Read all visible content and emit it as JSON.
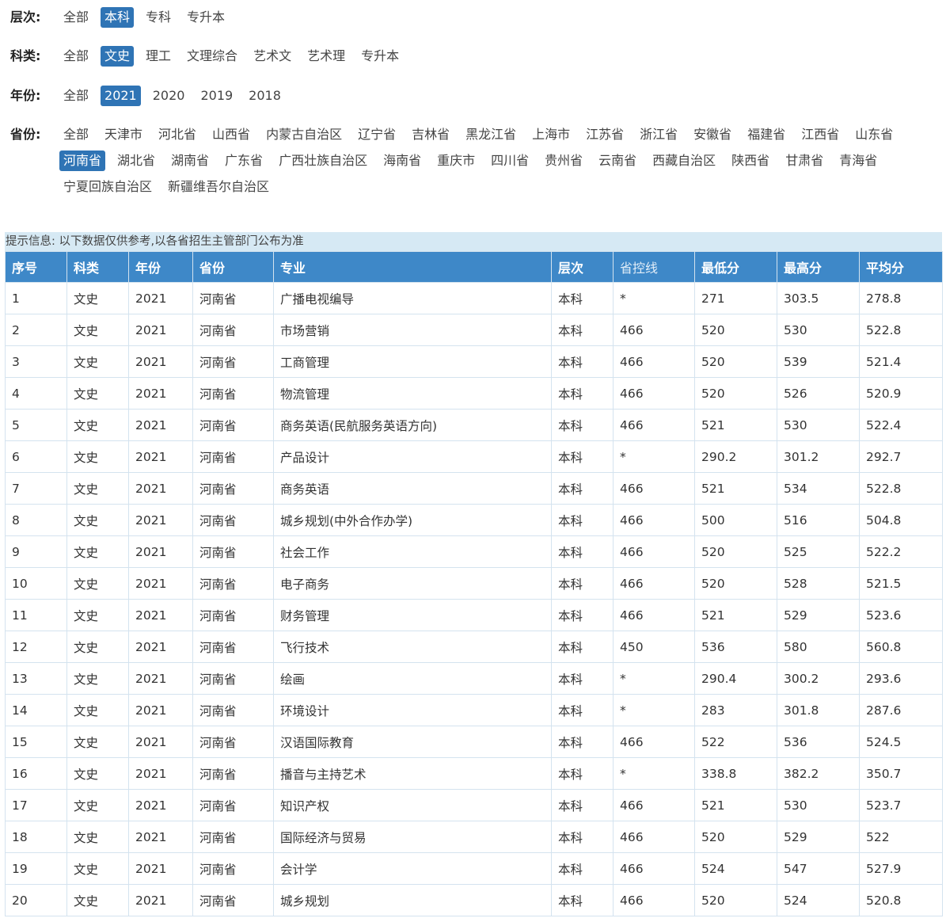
{
  "filters": {
    "level": {
      "label": "层次:",
      "options": [
        "全部",
        "本科",
        "专科",
        "专升本"
      ],
      "active": 1
    },
    "subject": {
      "label": "科类:",
      "options": [
        "全部",
        "文史",
        "理工",
        "文理综合",
        "艺术文",
        "艺术理",
        "专升本"
      ],
      "active": 1
    },
    "year": {
      "label": "年份:",
      "options": [
        "全部",
        "2021",
        "2020",
        "2019",
        "2018"
      ],
      "active": 1
    },
    "province": {
      "label": "省份:",
      "options": [
        "全部",
        "天津市",
        "河北省",
        "山西省",
        "内蒙古自治区",
        "辽宁省",
        "吉林省",
        "黑龙江省",
        "上海市",
        "江苏省",
        "浙江省",
        "安徽省",
        "福建省",
        "江西省",
        "山东省",
        "河南省",
        "湖北省",
        "湖南省",
        "广东省",
        "广西壮族自治区",
        "海南省",
        "重庆市",
        "四川省",
        "贵州省",
        "云南省",
        "西藏自治区",
        "陕西省",
        "甘肃省",
        "青海省",
        "宁夏回族自治区",
        "新疆维吾尔自治区"
      ],
      "active": 15
    }
  },
  "notice": "提示信息: 以下数据仅供参考,以各省招生主管部门公布为准",
  "table": {
    "headers": [
      "序号",
      "科类",
      "年份",
      "省份",
      "专业",
      "层次",
      "省控线",
      "最低分",
      "最高分",
      "平均分"
    ],
    "rows": [
      [
        "1",
        "文史",
        "2021",
        "河南省",
        "广播电视编导",
        "本科",
        "*",
        "271",
        "303.5",
        "278.8"
      ],
      [
        "2",
        "文史",
        "2021",
        "河南省",
        "市场营销",
        "本科",
        "466",
        "520",
        "530",
        "522.8"
      ],
      [
        "3",
        "文史",
        "2021",
        "河南省",
        "工商管理",
        "本科",
        "466",
        "520",
        "539",
        "521.4"
      ],
      [
        "4",
        "文史",
        "2021",
        "河南省",
        "物流管理",
        "本科",
        "466",
        "520",
        "526",
        "520.9"
      ],
      [
        "5",
        "文史",
        "2021",
        "河南省",
        "商务英语(民航服务英语方向)",
        "本科",
        "466",
        "521",
        "530",
        "522.4"
      ],
      [
        "6",
        "文史",
        "2021",
        "河南省",
        "产品设计",
        "本科",
        "*",
        "290.2",
        "301.2",
        "292.7"
      ],
      [
        "7",
        "文史",
        "2021",
        "河南省",
        "商务英语",
        "本科",
        "466",
        "521",
        "534",
        "522.8"
      ],
      [
        "8",
        "文史",
        "2021",
        "河南省",
        "城乡规划(中外合作办学)",
        "本科",
        "466",
        "500",
        "516",
        "504.8"
      ],
      [
        "9",
        "文史",
        "2021",
        "河南省",
        "社会工作",
        "本科",
        "466",
        "520",
        "525",
        "522.2"
      ],
      [
        "10",
        "文史",
        "2021",
        "河南省",
        "电子商务",
        "本科",
        "466",
        "520",
        "528",
        "521.5"
      ],
      [
        "11",
        "文史",
        "2021",
        "河南省",
        "财务管理",
        "本科",
        "466",
        "521",
        "529",
        "523.6"
      ],
      [
        "12",
        "文史",
        "2021",
        "河南省",
        "飞行技术",
        "本科",
        "450",
        "536",
        "580",
        "560.8"
      ],
      [
        "13",
        "文史",
        "2021",
        "河南省",
        "绘画",
        "本科",
        "*",
        "290.4",
        "300.2",
        "293.6"
      ],
      [
        "14",
        "文史",
        "2021",
        "河南省",
        "环境设计",
        "本科",
        "*",
        "283",
        "301.8",
        "287.6"
      ],
      [
        "15",
        "文史",
        "2021",
        "河南省",
        "汉语国际教育",
        "本科",
        "466",
        "522",
        "536",
        "524.5"
      ],
      [
        "16",
        "文史",
        "2021",
        "河南省",
        "播音与主持艺术",
        "本科",
        "*",
        "338.8",
        "382.2",
        "350.7"
      ],
      [
        "17",
        "文史",
        "2021",
        "河南省",
        "知识产权",
        "本科",
        "466",
        "521",
        "530",
        "523.7"
      ],
      [
        "18",
        "文史",
        "2021",
        "河南省",
        "国际经济与贸易",
        "本科",
        "466",
        "520",
        "529",
        "522"
      ],
      [
        "19",
        "文史",
        "2021",
        "河南省",
        "会计学",
        "本科",
        "466",
        "524",
        "547",
        "527.9"
      ],
      [
        "20",
        "文史",
        "2021",
        "河南省",
        "城乡规划",
        "本科",
        "466",
        "520",
        "524",
        "520.8"
      ]
    ]
  },
  "colors": {
    "accent": "#2f74b5",
    "header_bg": "#3e88c8",
    "notice_bg": "#d6e9f4",
    "border": "#d4e3ef"
  }
}
